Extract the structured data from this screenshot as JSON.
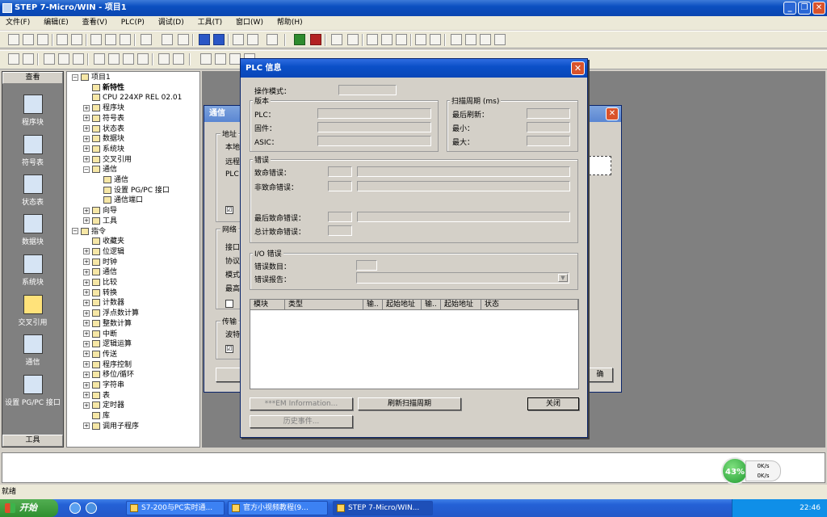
{
  "window": {
    "title": "STEP 7-Micro/WIN - 项目1"
  },
  "menu": [
    "文件(F)",
    "编辑(E)",
    "查看(V)",
    "PLC(P)",
    "调试(D)",
    "工具(T)",
    "窗口(W)",
    "帮助(H)"
  ],
  "navbar": {
    "header": "查看",
    "footer": "工具",
    "items": [
      "程序块",
      "符号表",
      "状态表",
      "数据块",
      "系统块",
      "交叉引用",
      "通信",
      "设置 PG/PC 接口"
    ]
  },
  "tree": {
    "nodes": [
      {
        "label": "项目1",
        "indent": 0,
        "exp": "−"
      },
      {
        "label": "新特性",
        "indent": 1,
        "exp": "",
        "bold": true
      },
      {
        "label": "CPU 224XP REL 02.01",
        "indent": 1,
        "exp": ""
      },
      {
        "label": "程序块",
        "indent": 1,
        "exp": "+"
      },
      {
        "label": "符号表",
        "indent": 1,
        "exp": "+"
      },
      {
        "label": "状态表",
        "indent": 1,
        "exp": "+"
      },
      {
        "label": "数据块",
        "indent": 1,
        "exp": "+"
      },
      {
        "label": "系统块",
        "indent": 1,
        "exp": "+"
      },
      {
        "label": "交叉引用",
        "indent": 1,
        "exp": "+"
      },
      {
        "label": "通信",
        "indent": 1,
        "exp": "−"
      },
      {
        "label": "通信",
        "indent": 2,
        "exp": ""
      },
      {
        "label": "设置 PG/PC 接口",
        "indent": 2,
        "exp": ""
      },
      {
        "label": "通信端口",
        "indent": 2,
        "exp": ""
      },
      {
        "label": "向导",
        "indent": 1,
        "exp": "+"
      },
      {
        "label": "工具",
        "indent": 1,
        "exp": "+"
      },
      {
        "label": "指令",
        "indent": 0,
        "exp": "−"
      },
      {
        "label": "收藏夹",
        "indent": 1,
        "exp": ""
      },
      {
        "label": "位逻辑",
        "indent": 1,
        "exp": "+"
      },
      {
        "label": "时钟",
        "indent": 1,
        "exp": "+"
      },
      {
        "label": "通信",
        "indent": 1,
        "exp": "+"
      },
      {
        "label": "比较",
        "indent": 1,
        "exp": "+"
      },
      {
        "label": "转换",
        "indent": 1,
        "exp": "+"
      },
      {
        "label": "计数器",
        "indent": 1,
        "exp": "+"
      },
      {
        "label": "浮点数计算",
        "indent": 1,
        "exp": "+"
      },
      {
        "label": "整数计算",
        "indent": 1,
        "exp": "+"
      },
      {
        "label": "中断",
        "indent": 1,
        "exp": "+"
      },
      {
        "label": "逻辑运算",
        "indent": 1,
        "exp": "+"
      },
      {
        "label": "传送",
        "indent": 1,
        "exp": "+"
      },
      {
        "label": "程序控制",
        "indent": 1,
        "exp": "+"
      },
      {
        "label": "移位/循环",
        "indent": 1,
        "exp": "+"
      },
      {
        "label": "字符串",
        "indent": 1,
        "exp": "+"
      },
      {
        "label": "表",
        "indent": 1,
        "exp": "+"
      },
      {
        "label": "定时器",
        "indent": 1,
        "exp": "+"
      },
      {
        "label": "库",
        "indent": 1,
        "exp": ""
      },
      {
        "label": "调用子程序",
        "indent": 1,
        "exp": "+"
      }
    ]
  },
  "comm_dialog": {
    "title": "通信",
    "address_group": "地址",
    "local": "本地",
    "remote": "远程",
    "plc": "PLC",
    "network_group": "网络",
    "interface": "接口",
    "protocol": "协议",
    "mode": "模式",
    "highest": "最高",
    "transfer_group": "传输",
    "baud": "波特",
    "check1": "☑",
    "check3": "☑",
    "btn_right": "确"
  },
  "plc_info": {
    "title": "PLC 信息",
    "op_mode": "操作模式：",
    "version_group": "版本",
    "plc": "PLC：",
    "firmware": "固件：",
    "asic": "ASIC：",
    "scan_group": "扫描周期 (ms)",
    "last_scan": "最后刷新：",
    "min": "最小：",
    "max": "最大：",
    "error_group": "错误",
    "fatal_error": "致命错误：",
    "nonfatal_error": "非致命错误：",
    "last_fatal": "最后致命错误：",
    "total_fatal": "总计致命错误：",
    "io_group": "I/O 错误",
    "error_count": "错误数目：",
    "error_report": "错误报告：",
    "columns": [
      "模块",
      "类型",
      "输..",
      "起始地址",
      "输..",
      "起始地址",
      "状态"
    ],
    "btn_em_info": "***EM Information...",
    "btn_refresh": "刷新扫描周期",
    "btn_close": "关闭",
    "btn_history": "历史事件..."
  },
  "status": {
    "text": "就绪"
  },
  "netmeter": {
    "percent": "43%",
    "up": "0K/s",
    "down": "0K/s"
  },
  "taskbar": {
    "start": "开始",
    "tasks": [
      "S7-200与PC实时通...",
      "官方小视频教程(9...",
      "STEP 7-Micro/WIN..."
    ],
    "clock": "22:46"
  }
}
